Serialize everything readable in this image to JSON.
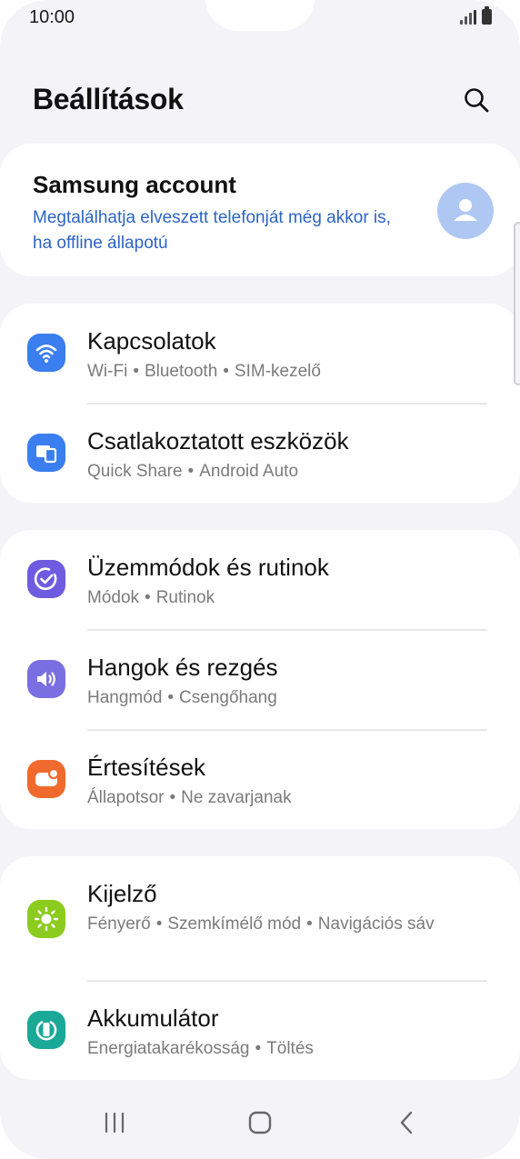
{
  "status_bar": {
    "time": "10:00"
  },
  "header": {
    "title": "Beállítások",
    "search_icon": "search-icon"
  },
  "account": {
    "title": "Samsung account",
    "subtitle": "Megtalálhatja elveszett telefonját még akkor is, ha offline állapotú",
    "icon": "user-avatar-icon"
  },
  "groups": [
    {
      "items": [
        {
          "icon": "wifi-icon",
          "color": "#3a7ef0",
          "title": "Kapcsolatok",
          "subs": [
            "Wi-Fi",
            "Bluetooth",
            "SIM-kezelő"
          ]
        },
        {
          "icon": "connected-devices-icon",
          "color": "#3a7ef0",
          "title": "Csatlakoztatott eszközök",
          "subs": [
            "Quick Share",
            "Android Auto"
          ]
        }
      ]
    },
    {
      "items": [
        {
          "icon": "modes-routines-icon",
          "color": "#6d5ce0",
          "title": "Üzemmódok és rutinok",
          "subs": [
            "Módok",
            "Rutinok"
          ]
        },
        {
          "icon": "sound-icon",
          "color": "#7a6fe2",
          "title": "Hangok és rezgés",
          "subs": [
            "Hangmód",
            "Csengőhang"
          ]
        },
        {
          "icon": "notifications-icon",
          "color": "#ef6a2c",
          "title": "Értesítések",
          "subs": [
            "Állapotsor",
            "Ne zavarjanak"
          ]
        }
      ]
    },
    {
      "items": [
        {
          "icon": "display-brightness-icon",
          "color": "#8ccc1f",
          "title": "Kijelző",
          "subs": [
            "Fényerő",
            "Szemkímélő mód",
            "Navigációs sáv"
          ]
        },
        {
          "icon": "battery-icon",
          "color": "#1aa897",
          "title": "Akkumulátor",
          "subs": [
            "Energiatakarékosság",
            "Töltés"
          ]
        }
      ]
    }
  ],
  "navbar": {
    "recents": "recents-icon",
    "home": "home-icon",
    "back": "back-icon"
  }
}
